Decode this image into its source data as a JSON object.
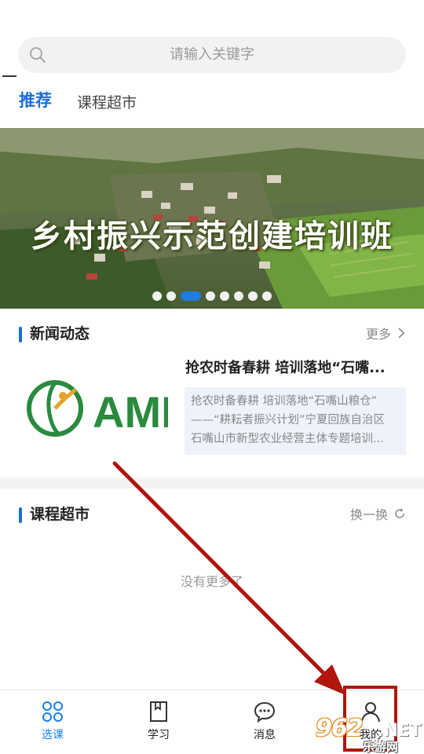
{
  "search": {
    "placeholder": "请输入关键字",
    "icon": "search-icon"
  },
  "tabs": [
    {
      "label": "推荐",
      "active": true
    },
    {
      "label": "课程超市",
      "active": false
    }
  ],
  "banner": {
    "title": "乡村振兴示范创建培训班",
    "dot_count": 8,
    "active_dot": 2
  },
  "news": {
    "section_title": "新闻动态",
    "more_label": "更多",
    "item": {
      "logo_text": "AMI",
      "title": "抢农时备春耕 培训落地“石嘴...",
      "summary_lines": [
        "抢农时备春耕 培训落地“石嘴山粮仓”",
        "——“耕耘者振兴计划”宁夏回族自治区",
        "石嘴山市新型农业经营主体专题培训..."
      ]
    }
  },
  "courses": {
    "section_title": "课程超市",
    "refresh_label": "换一换",
    "empty_text": "没有更多了"
  },
  "bottom_nav": [
    {
      "label": "选课",
      "icon": "courses-icon",
      "active": true
    },
    {
      "label": "学习",
      "icon": "book-icon",
      "active": false
    },
    {
      "label": "消息",
      "icon": "chat-icon",
      "active": false
    },
    {
      "label": "我的",
      "icon": "user-icon",
      "active": false
    }
  ],
  "watermark": {
    "number": "962",
    "suffix": ".NET",
    "sub": "乐游网"
  },
  "colors": {
    "accent": "#1a6fd6",
    "active_nav": "#1a7ff0",
    "annotation": "#b0150e"
  }
}
